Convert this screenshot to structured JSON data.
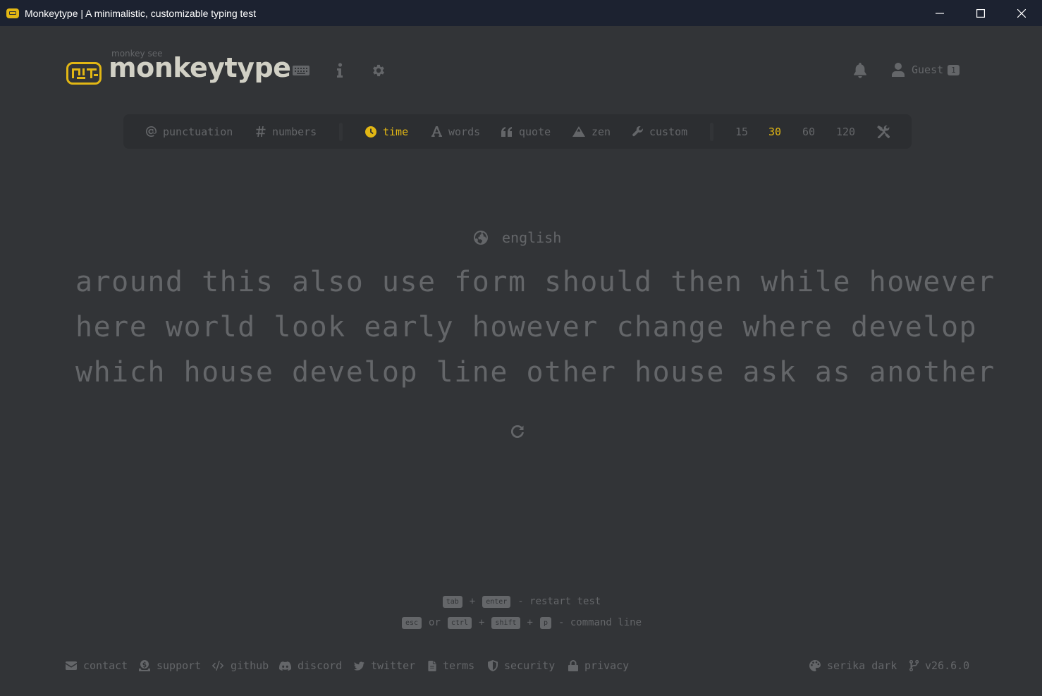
{
  "window": {
    "title": "Monkeytype | A minimalistic, customizable typing test",
    "app_icon": "monkeytype-app-icon",
    "controls": [
      "minimize",
      "maximize",
      "close"
    ]
  },
  "header": {
    "logo_top": "monkey see",
    "logo_text": "monkeytype",
    "nav_icons": [
      "keyboard-icon",
      "info-icon",
      "settings-icon"
    ],
    "notifications_icon": "bell-icon",
    "user": {
      "name": "Guest",
      "badge": "1"
    }
  },
  "config_bar": {
    "punctuation": "punctuation",
    "numbers": "numbers",
    "modes": [
      {
        "label": "time",
        "icon": "clock-icon",
        "active": true
      },
      {
        "label": "words",
        "icon": "font-icon",
        "active": false
      },
      {
        "label": "quote",
        "icon": "quote-icon",
        "active": false
      },
      {
        "label": "zen",
        "icon": "mountain-icon",
        "active": false
      },
      {
        "label": "custom",
        "icon": "wrench-icon",
        "active": false
      }
    ],
    "durations": [
      {
        "label": "15",
        "active": false
      },
      {
        "label": "30",
        "active": true
      },
      {
        "label": "60",
        "active": false
      },
      {
        "label": "120",
        "active": false
      }
    ],
    "tools_icon": "tools-icon"
  },
  "test": {
    "language": "english",
    "lines": [
      "around this also use form should then while however",
      "here world look early however change where develop",
      "which house develop line other house ask as another"
    ],
    "restart_icon": "restart-icon"
  },
  "hints": {
    "row1": {
      "key1": "tab",
      "plus": "+",
      "key2": "enter",
      "text": "- restart test"
    },
    "row2": {
      "key1": "esc",
      "or": "or",
      "key2": "ctrl",
      "plus1": "+",
      "key3": "shift",
      "plus2": "+",
      "key4": "p",
      "text": "- command line"
    }
  },
  "footer": {
    "contact": "contact",
    "support": "support",
    "github": "github",
    "discord": "discord",
    "twitter": "twitter",
    "terms": "terms",
    "security": "security",
    "privacy": "privacy",
    "theme": "serika dark",
    "version": "v26.6.0"
  },
  "colors": {
    "background": "#323437",
    "sub_background": "#2c2e31",
    "main_accent": "#e2b714",
    "sub_text": "#646669",
    "text": "#d1d0c5",
    "titlebar": "#1c2230"
  }
}
